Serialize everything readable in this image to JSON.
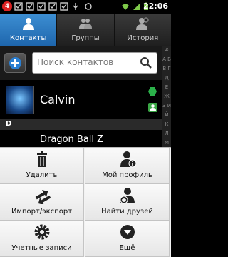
{
  "status_bar": {
    "notification_count": "4",
    "time": "22:06"
  },
  "tabs": [
    {
      "label": "Контакты",
      "icon": "contacts-icon",
      "active": true
    },
    {
      "label": "Группы",
      "icon": "groups-icon",
      "active": false
    },
    {
      "label": "История",
      "icon": "history-icon",
      "active": false
    }
  ],
  "search": {
    "placeholder": "Поиск контактов"
  },
  "alphabet_index": "# А Б В Г Д Е Ж З И Й К Л М Н",
  "contacts": [
    {
      "name": "Calvin"
    },
    {
      "name": "Dragon Ball Z"
    }
  ],
  "section_letter": "D",
  "menu": {
    "delete": "Удалить",
    "my_profile": "Мой профиль",
    "import_export": "Импорт/экспорт",
    "find_friends": "Найти друзей",
    "accounts": "Учетные записи",
    "more": "Ещё"
  },
  "colors": {
    "tab_active": "#2f7dc8",
    "accent_green": "#2bb14a"
  }
}
